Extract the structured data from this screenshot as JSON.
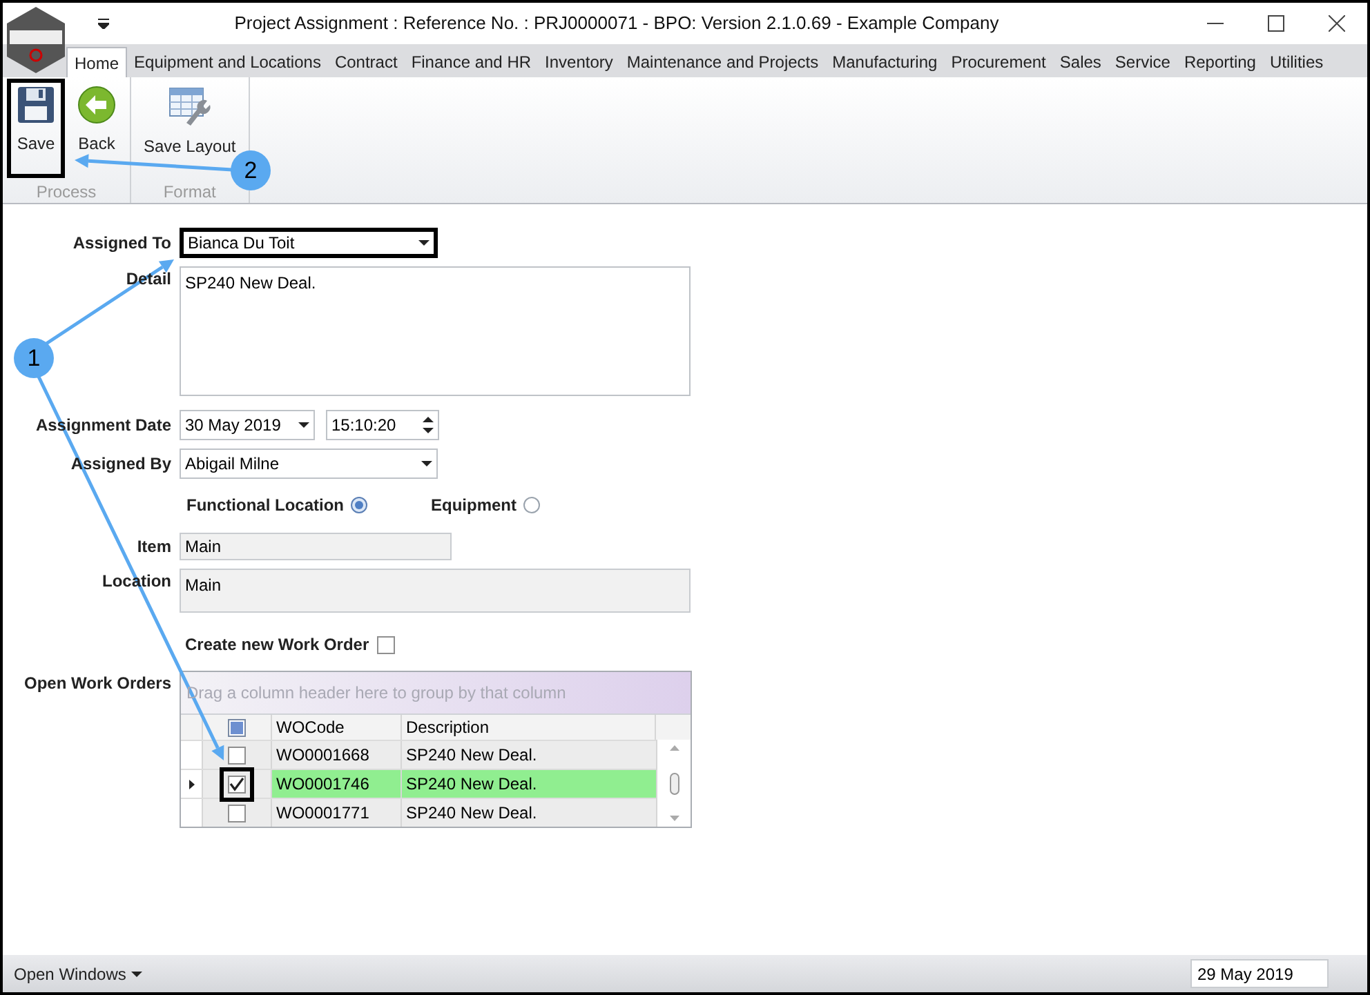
{
  "window": {
    "title": "Project Assignment : Reference No. : PRJ0000071 - BPO: Version 2.1.0.69 - Example Company"
  },
  "tabs": [
    {
      "label": "Home",
      "selected": true
    },
    {
      "label": "Equipment and Locations",
      "selected": false
    },
    {
      "label": "Contract",
      "selected": false
    },
    {
      "label": "Finance and HR",
      "selected": false
    },
    {
      "label": "Inventory",
      "selected": false
    },
    {
      "label": "Maintenance and Projects",
      "selected": false
    },
    {
      "label": "Manufacturing",
      "selected": false
    },
    {
      "label": "Procurement",
      "selected": false
    },
    {
      "label": "Sales",
      "selected": false
    },
    {
      "label": "Service",
      "selected": false
    },
    {
      "label": "Reporting",
      "selected": false
    },
    {
      "label": "Utilities",
      "selected": false
    }
  ],
  "ribbon": [
    {
      "label": "Process",
      "buttons": [
        {
          "kind": "save",
          "label": "Save",
          "highlighted": true
        },
        {
          "kind": "back",
          "label": "Back",
          "highlighted": false
        }
      ]
    },
    {
      "label": "Format",
      "buttons": [
        {
          "kind": "layout",
          "label": "Save Layout",
          "highlighted": false
        }
      ]
    }
  ],
  "form": {
    "assigned_to": {
      "label": "Assigned To",
      "value": "Bianca Du Toit",
      "highlighted": true
    },
    "detail": {
      "label": "Detail",
      "value": "SP240 New Deal."
    },
    "assignment_date": {
      "label": "Assignment Date",
      "date": "30 May 2019",
      "time": "15:10:20"
    },
    "assigned_by": {
      "label": "Assigned By",
      "value": "Abigail Milne"
    },
    "radios": [
      {
        "label": "Functional Location",
        "selected": true
      },
      {
        "label": "Equipment",
        "selected": false
      }
    ],
    "item": {
      "label": "Item",
      "value": "Main"
    },
    "location": {
      "label": "Location",
      "value": "Main"
    },
    "create_work_order": {
      "label": "Create new Work Order",
      "checked": false
    },
    "open_work_orders": {
      "label": "Open Work Orders",
      "group_hint": "Drag a column header here to group by that column",
      "columns": [
        "WOCode",
        "Description"
      ],
      "select_all_indeterminate": true,
      "rows": [
        {
          "code": "WO0001668",
          "description": "SP240 New Deal.",
          "checked": false,
          "selected": false,
          "highlighted": false
        },
        {
          "code": "WO0001746",
          "description": "SP240 New Deal.",
          "checked": true,
          "selected": true,
          "highlighted": true
        },
        {
          "code": "WO0001771",
          "description": "SP240 New Deal.",
          "checked": false,
          "selected": false,
          "highlighted": false
        }
      ]
    }
  },
  "callouts": [
    {
      "label": "1"
    },
    {
      "label": "2"
    }
  ],
  "status_bar": {
    "open_windows": "Open Windows",
    "date": "29 May 2019"
  }
}
